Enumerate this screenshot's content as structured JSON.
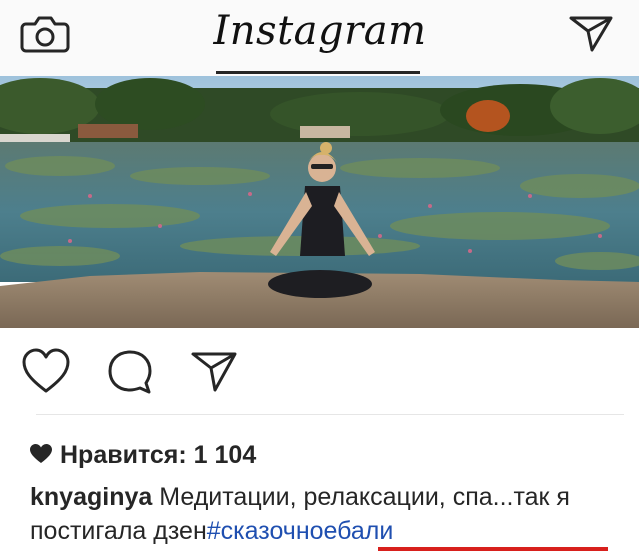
{
  "header": {
    "logo_text": "Instagram",
    "camera_icon": "camera-icon",
    "direct_icon": "paper-plane-icon"
  },
  "post": {
    "photo_icon": "post-photo",
    "actions": {
      "like_icon": "heart-outline-icon",
      "comment_icon": "comment-bubble-icon",
      "share_icon": "paper-plane-icon"
    },
    "likes": {
      "heart_icon": "heart-filled-icon",
      "label": "Нравится:",
      "count": "1 104"
    },
    "caption": {
      "username": "knyaginya",
      "text": "Медитации, релаксации, спа...так я постигала дзен",
      "hashtag": "#сказочноебали"
    }
  },
  "colors": {
    "header_bg": "#fafafa",
    "text": "#262626",
    "hashtag": "#1f4fb0",
    "highlight_underline": "#d8201d"
  }
}
